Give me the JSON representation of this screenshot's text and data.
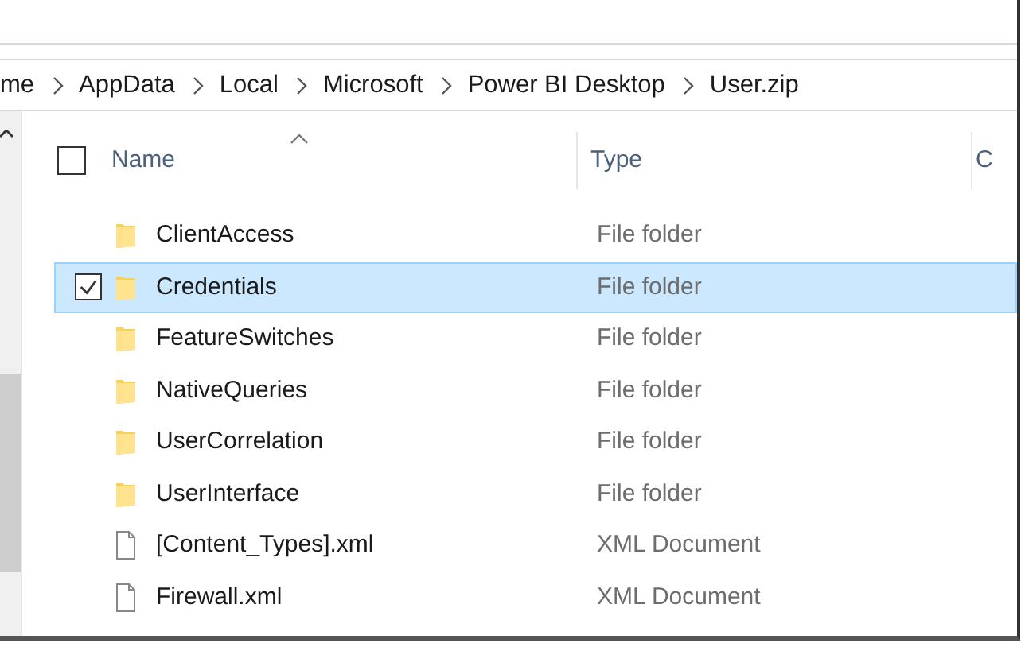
{
  "breadcrumb": [
    {
      "label": "me"
    },
    {
      "label": "AppData"
    },
    {
      "label": "Local"
    },
    {
      "label": "Microsoft"
    },
    {
      "label": "Power BI Desktop"
    },
    {
      "label": "User.zip"
    }
  ],
  "select_all": {
    "checked": false
  },
  "columns": [
    {
      "label": "Name",
      "sorted": true
    },
    {
      "label": "Type",
      "sorted": false
    },
    {
      "label": "C",
      "sorted": false
    }
  ],
  "rows": [
    {
      "name": "ClientAccess",
      "type": "File folder",
      "kind": "folder",
      "selected": false,
      "checked": false
    },
    {
      "name": "Credentials",
      "type": "File folder",
      "kind": "folder",
      "selected": true,
      "checked": true
    },
    {
      "name": "FeatureSwitches",
      "type": "File folder",
      "kind": "folder",
      "selected": false,
      "checked": false
    },
    {
      "name": "NativeQueries",
      "type": "File folder",
      "kind": "folder",
      "selected": false,
      "checked": false
    },
    {
      "name": "UserCorrelation",
      "type": "File folder",
      "kind": "folder",
      "selected": false,
      "checked": false
    },
    {
      "name": "UserInterface",
      "type": "File folder",
      "kind": "folder",
      "selected": false,
      "checked": false
    },
    {
      "name": "[Content_Types].xml",
      "type": "XML Document",
      "kind": "file",
      "selected": false,
      "checked": false
    },
    {
      "name": "Firewall.xml",
      "type": "XML Document",
      "kind": "file",
      "selected": false,
      "checked": false
    }
  ]
}
